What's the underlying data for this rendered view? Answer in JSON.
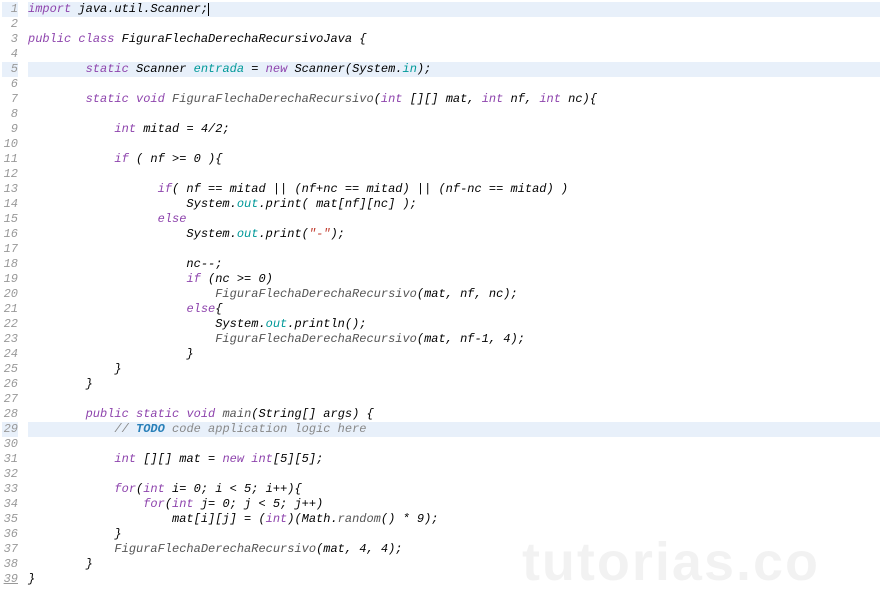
{
  "watermark": "tutorias.co",
  "lines": [
    {
      "n": 1,
      "hl": true,
      "underline": false,
      "tokens": [
        [
          "kw",
          "import"
        ],
        [
          "",
          " java.util.Scanner;"
        ]
      ],
      "cursor": true
    },
    {
      "n": 2,
      "hl": false,
      "tokens": [
        [
          "",
          ""
        ]
      ]
    },
    {
      "n": 3,
      "hl": false,
      "tokens": [
        [
          "kw",
          "public"
        ],
        [
          "",
          " "
        ],
        [
          "kw",
          "class"
        ],
        [
          "",
          " FiguraFlechaDerechaRecursivoJava {"
        ]
      ]
    },
    {
      "n": 4,
      "hl": false,
      "tokens": [
        [
          "",
          ""
        ]
      ]
    },
    {
      "n": 5,
      "hl": true,
      "tokens": [
        [
          "",
          "        "
        ],
        [
          "kw",
          "static"
        ],
        [
          "",
          " Scanner "
        ],
        [
          "teal",
          "entrada"
        ],
        [
          "",
          " = "
        ],
        [
          "kw",
          "new"
        ],
        [
          "",
          " Scanner(System."
        ],
        [
          "teal",
          "in"
        ],
        [
          "",
          ");"
        ]
      ]
    },
    {
      "n": 6,
      "hl": false,
      "tokens": [
        [
          "",
          ""
        ]
      ]
    },
    {
      "n": 7,
      "hl": false,
      "tokens": [
        [
          "",
          "        "
        ],
        [
          "kw",
          "static"
        ],
        [
          "",
          " "
        ],
        [
          "kw",
          "void"
        ],
        [
          "",
          " "
        ],
        [
          "meth",
          "FiguraFlechaDerechaRecursivo"
        ],
        [
          "",
          "("
        ],
        [
          "kw",
          "int"
        ],
        [
          "",
          " [][] mat, "
        ],
        [
          "kw",
          "int"
        ],
        [
          "",
          " nf, "
        ],
        [
          "kw",
          "int"
        ],
        [
          "",
          " nc){"
        ]
      ]
    },
    {
      "n": 8,
      "hl": false,
      "tokens": [
        [
          "",
          ""
        ]
      ]
    },
    {
      "n": 9,
      "hl": false,
      "tokens": [
        [
          "",
          "            "
        ],
        [
          "kw",
          "int"
        ],
        [
          "",
          " mitad = 4/2;"
        ]
      ]
    },
    {
      "n": 10,
      "hl": false,
      "tokens": [
        [
          "",
          ""
        ]
      ]
    },
    {
      "n": 11,
      "hl": false,
      "tokens": [
        [
          "",
          "            "
        ],
        [
          "kw",
          "if"
        ],
        [
          "",
          " ( nf >= 0 ){"
        ]
      ]
    },
    {
      "n": 12,
      "hl": false,
      "tokens": [
        [
          "",
          ""
        ]
      ]
    },
    {
      "n": 13,
      "hl": false,
      "tokens": [
        [
          "",
          "                  "
        ],
        [
          "kw",
          "if"
        ],
        [
          "",
          "( nf == mitad || (nf+nc == mitad) || (nf-nc == mitad) )"
        ]
      ]
    },
    {
      "n": 14,
      "hl": false,
      "tokens": [
        [
          "",
          "                      System."
        ],
        [
          "teal",
          "out"
        ],
        [
          "",
          ".print( mat[nf][nc] );"
        ]
      ]
    },
    {
      "n": 15,
      "hl": false,
      "tokens": [
        [
          "",
          "                  "
        ],
        [
          "kw",
          "else"
        ]
      ]
    },
    {
      "n": 16,
      "hl": false,
      "tokens": [
        [
          "",
          "                      System."
        ],
        [
          "teal",
          "out"
        ],
        [
          "",
          ".print("
        ],
        [
          "str",
          "\"-\""
        ],
        [
          "",
          ");"
        ]
      ]
    },
    {
      "n": 17,
      "hl": false,
      "tokens": [
        [
          "",
          ""
        ]
      ]
    },
    {
      "n": 18,
      "hl": false,
      "tokens": [
        [
          "",
          "                      nc--;"
        ]
      ]
    },
    {
      "n": 19,
      "hl": false,
      "tokens": [
        [
          "",
          "                      "
        ],
        [
          "kw",
          "if"
        ],
        [
          "",
          " (nc >= 0)"
        ]
      ]
    },
    {
      "n": 20,
      "hl": false,
      "tokens": [
        [
          "",
          "                          "
        ],
        [
          "meth",
          "FiguraFlechaDerechaRecursivo"
        ],
        [
          "",
          "(mat, nf, nc);"
        ]
      ]
    },
    {
      "n": 21,
      "hl": false,
      "tokens": [
        [
          "",
          "                      "
        ],
        [
          "kw",
          "else"
        ],
        [
          "",
          "{"
        ]
      ]
    },
    {
      "n": 22,
      "hl": false,
      "tokens": [
        [
          "",
          "                          System."
        ],
        [
          "teal",
          "out"
        ],
        [
          "",
          ".println();"
        ]
      ]
    },
    {
      "n": 23,
      "hl": false,
      "tokens": [
        [
          "",
          "                          "
        ],
        [
          "meth",
          "FiguraFlechaDerechaRecursivo"
        ],
        [
          "",
          "(mat, nf-1, 4);"
        ]
      ]
    },
    {
      "n": 24,
      "hl": false,
      "tokens": [
        [
          "",
          "                      }"
        ]
      ]
    },
    {
      "n": 25,
      "hl": false,
      "tokens": [
        [
          "",
          "            }"
        ]
      ]
    },
    {
      "n": 26,
      "hl": false,
      "tokens": [
        [
          "",
          "        }"
        ]
      ]
    },
    {
      "n": 27,
      "hl": false,
      "tokens": [
        [
          "",
          ""
        ]
      ]
    },
    {
      "n": 28,
      "hl": false,
      "tokens": [
        [
          "",
          "        "
        ],
        [
          "kw",
          "public"
        ],
        [
          "",
          " "
        ],
        [
          "kw",
          "static"
        ],
        [
          "",
          " "
        ],
        [
          "kw",
          "void"
        ],
        [
          "",
          " "
        ],
        [
          "meth",
          "main"
        ],
        [
          "",
          "(String[] args) {"
        ]
      ]
    },
    {
      "n": 29,
      "hl": true,
      "tokens": [
        [
          "",
          "            "
        ],
        [
          "cmt",
          "// "
        ],
        [
          "todo",
          "TODO"
        ],
        [
          "cmt",
          " code application logic here"
        ]
      ]
    },
    {
      "n": 30,
      "hl": false,
      "tokens": [
        [
          "",
          ""
        ]
      ]
    },
    {
      "n": 31,
      "hl": false,
      "tokens": [
        [
          "",
          "            "
        ],
        [
          "kw",
          "int"
        ],
        [
          "",
          " [][] mat = "
        ],
        [
          "kw",
          "new"
        ],
        [
          "",
          " "
        ],
        [
          "kw",
          "int"
        ],
        [
          "",
          "[5][5];"
        ]
      ]
    },
    {
      "n": 32,
      "hl": false,
      "tokens": [
        [
          "",
          ""
        ]
      ]
    },
    {
      "n": 33,
      "hl": false,
      "tokens": [
        [
          "",
          "            "
        ],
        [
          "kw",
          "for"
        ],
        [
          "",
          "("
        ],
        [
          "kw",
          "int"
        ],
        [
          "",
          " i= 0; i < 5; i++){"
        ]
      ]
    },
    {
      "n": 34,
      "hl": false,
      "tokens": [
        [
          "",
          "                "
        ],
        [
          "kw",
          "for"
        ],
        [
          "",
          "("
        ],
        [
          "kw",
          "int"
        ],
        [
          "",
          " j= 0; j < 5; j++)"
        ]
      ]
    },
    {
      "n": 35,
      "hl": false,
      "tokens": [
        [
          "",
          "                    mat[i][j] = ("
        ],
        [
          "kw",
          "int"
        ],
        [
          "",
          ")(Math."
        ],
        [
          "meth",
          "random"
        ],
        [
          "",
          "() * 9);"
        ]
      ]
    },
    {
      "n": 36,
      "hl": false,
      "tokens": [
        [
          "",
          "            }"
        ]
      ]
    },
    {
      "n": 37,
      "hl": false,
      "tokens": [
        [
          "",
          "            "
        ],
        [
          "meth",
          "FiguraFlechaDerechaRecursivo"
        ],
        [
          "",
          "(mat, 4, 4);"
        ]
      ]
    },
    {
      "n": 38,
      "hl": false,
      "tokens": [
        [
          "",
          "        }"
        ]
      ]
    },
    {
      "n": 39,
      "hl": false,
      "underline": true,
      "tokens": [
        [
          "",
          ""
        ],
        [
          "",
          "}"
        ]
      ]
    }
  ]
}
